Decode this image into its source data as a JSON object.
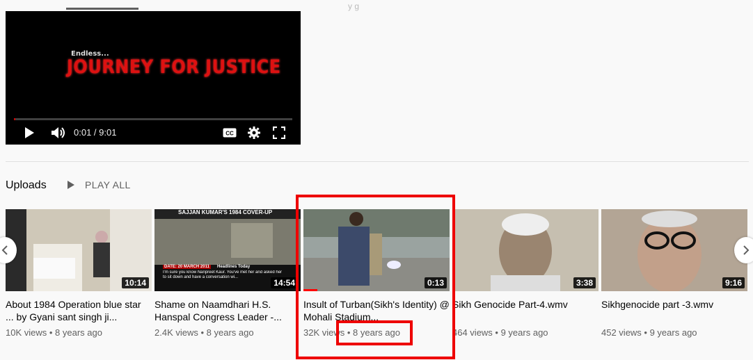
{
  "top": {
    "partial_text": "y    g"
  },
  "player": {
    "art_line1": "Endless...",
    "art_line2": "JOURNEY FOR JUSTICE",
    "time": "0:01 / 9:01",
    "progress": 0.002
  },
  "shelf": {
    "title": "Uploads",
    "play_all": "PLAY ALL"
  },
  "videos": [
    {
      "title": "About 1984 Operation blue star ... by Gyani sant singh ji...",
      "duration": "10:14",
      "views": "10K views",
      "age": "8 years ago"
    },
    {
      "title": "Shame on Naamdhari H.S. Hanspal Congress Leader -...",
      "duration": "14:54",
      "views": "2.4K views",
      "age": "8 years ago",
      "thumb_banner": "SAJJAN KUMAR'S 1984 COVER-UP",
      "thumb_date": "DATE: 20 MARCH 2011",
      "thumb_headline": "Headlines Today",
      "thumb_caption": "I'm sure you know Nanpreet Kaur. You've met her and asked her to sit down and have a conversation wi..."
    },
    {
      "title": "Insult of Turban(Sikh's Identity) @ Mohali Stadium...",
      "duration": "0:13",
      "views": "32K views",
      "age": "8 years ago"
    },
    {
      "title": "Sikh Genocide Part-4.wmv",
      "duration": "3:38",
      "views": "464 views",
      "age": "9 years ago"
    },
    {
      "title": "Sikhgenocide part -3.wmv",
      "duration": "9:16",
      "views": "452 views",
      "age": "9 years ago"
    }
  ],
  "colors": {
    "annotation": "#e00000",
    "accent": "#ff0000"
  }
}
